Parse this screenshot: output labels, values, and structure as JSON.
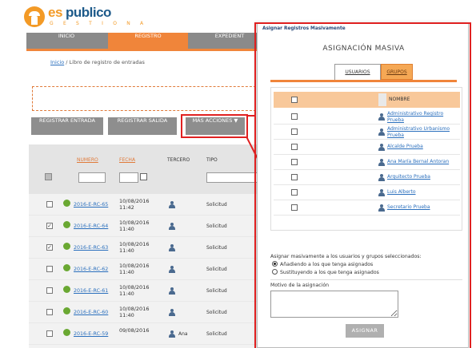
{
  "brand": {
    "logo_es": "es",
    "logo_pub": "publico",
    "logo_sub": "G E S T I O N A"
  },
  "nav": {
    "tabs": [
      {
        "label": "INICIO"
      },
      {
        "label": "REGISTRO"
      },
      {
        "label": "EXPEDIENT"
      }
    ]
  },
  "breadcrumb": {
    "home": "Inicio",
    "sep": " / ",
    "current": "Libro de registro de entradas"
  },
  "toolbar": {
    "registrar_entrada": "REGISTRAR ENTRADA",
    "registrar_salida": "REGISTRAR SALIDA",
    "mas_acciones": "MÁS ACCIONES ▼"
  },
  "table": {
    "headers": {
      "numero": "NUMERO",
      "fecha": "FECHA",
      "tercero": "TERCERO",
      "tipo": "TIPO"
    },
    "rows": [
      {
        "checked": false,
        "numero": "2016-E-RC-65",
        "date": "10/08/2016",
        "time": "11:42",
        "tercero": "",
        "tipo": "Solicitud"
      },
      {
        "checked": true,
        "numero": "2016-E-RC-64",
        "date": "10/08/2016",
        "time": "11:40",
        "tercero": "",
        "tipo": "Solicitud"
      },
      {
        "checked": true,
        "numero": "2016-E-RC-63",
        "date": "10/08/2016",
        "time": "11:40",
        "tercero": "",
        "tipo": "Solicitud"
      },
      {
        "checked": false,
        "numero": "2016-E-RC-62",
        "date": "10/08/2016",
        "time": "11:40",
        "tercero": "",
        "tipo": "Solicitud"
      },
      {
        "checked": false,
        "numero": "2016-E-RC-61",
        "date": "10/08/2016",
        "time": "11:40",
        "tercero": "",
        "tipo": "Solicitud"
      },
      {
        "checked": false,
        "numero": "2016-E-RC-60",
        "date": "10/08/2016",
        "time": "11:40",
        "tercero": "",
        "tipo": "Solicitud"
      },
      {
        "checked": false,
        "numero": "2016-E-RC-59",
        "date": "09/08/2016",
        "time": "",
        "tercero": "Ana",
        "tipo": "Solicitud"
      }
    ]
  },
  "modal": {
    "window_title": "Asignar Registros Masivamente",
    "heading": "ASIGNACIÓN MASIVA",
    "tab_users": "USUARIOS",
    "tab_groups": "GRUPOS",
    "list_header_name": "NOMBRE",
    "users": [
      "Administrativo Registro Prueba",
      "Administrativo Urbanismo Prueba",
      "Alcalde Prueba",
      "Ana María Bernal Antoran",
      "Arquitecto Prueba",
      "Luis Alberto",
      "Secretario Prueba"
    ],
    "assign_label": "Asignar masivamente a los usuarios y grupos seleccionados:",
    "option_add": "Añadiendo a los que tenga asignados",
    "option_replace": "Sustituyendo a los que tenga asignados",
    "motivo_label": "Motivo de la asignación",
    "motivo_value": "",
    "assign_button": "ASIGNAR"
  },
  "colors": {
    "accent": "#f0853a",
    "link": "#2a6fbd",
    "highlight": "#e02020",
    "nav_grey": "#8a8a8a"
  }
}
